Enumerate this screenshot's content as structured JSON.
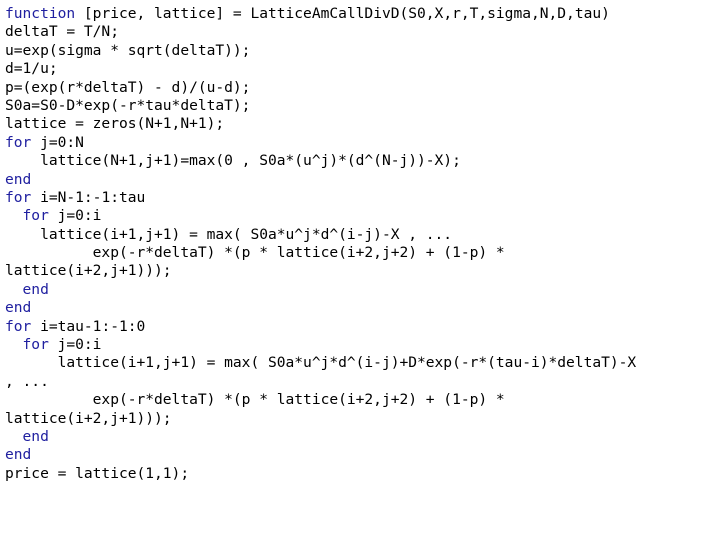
{
  "document": {
    "type": "source-code-listing",
    "language": "MATLAB",
    "function_name": "LatticeAmCallDivD",
    "background_color": "#ffffff",
    "text_color": "#000000",
    "keyword_color": "#2020a0",
    "keywords": [
      "function",
      "for",
      "end"
    ],
    "lines": [
      {
        "id": "line-1",
        "keyword": "function",
        "rest": " [price, lattice] = LatticeAmCallDivD(S0,X,r,T,sigma,N,D,tau)"
      },
      {
        "id": "line-2",
        "keyword": "",
        "rest": "deltaT = T/N;"
      },
      {
        "id": "line-3",
        "keyword": "",
        "rest": "u=exp(sigma * sqrt(deltaT));"
      },
      {
        "id": "line-4",
        "keyword": "",
        "rest": "d=1/u;"
      },
      {
        "id": "line-5",
        "keyword": "",
        "rest": "p=(exp(r*deltaT) - d)/(u-d);"
      },
      {
        "id": "line-6",
        "keyword": "",
        "rest": "S0a=S0-D*exp(-r*tau*deltaT);"
      },
      {
        "id": "line-7",
        "keyword": "",
        "rest": "lattice = zeros(N+1,N+1);"
      },
      {
        "id": "line-8",
        "keyword": "for",
        "rest": " j=0:N"
      },
      {
        "id": "line-9",
        "keyword": "",
        "rest": "    lattice(N+1,j+1)=max(0 , S0a*(u^j)*(d^(N-j))-X);"
      },
      {
        "id": "line-10",
        "keyword": "end",
        "rest": ""
      },
      {
        "id": "line-11",
        "keyword": "for",
        "rest": " i=N-1:-1:tau"
      },
      {
        "id": "line-12",
        "keyword": "  for",
        "rest": " j=0:i"
      },
      {
        "id": "line-13",
        "keyword": "",
        "rest": "    lattice(i+1,j+1) = max( S0a*u^j*d^(i-j)-X , ..."
      },
      {
        "id": "line-14",
        "keyword": "",
        "rest": "          exp(-r*deltaT) *(p * lattice(i+2,j+2) + (1-p) *"
      },
      {
        "id": "line-15",
        "keyword": "",
        "rest": "lattice(i+2,j+1)));"
      },
      {
        "id": "line-16",
        "keyword": "  end",
        "rest": ""
      },
      {
        "id": "line-17",
        "keyword": "end",
        "rest": ""
      },
      {
        "id": "line-18",
        "keyword": "for",
        "rest": " i=tau-1:-1:0"
      },
      {
        "id": "line-19",
        "keyword": "  for",
        "rest": " j=0:i"
      },
      {
        "id": "line-20",
        "keyword": "",
        "rest": "      lattice(i+1,j+1) = max( S0a*u^j*d^(i-j)+D*exp(-r*(tau-i)*deltaT)-X"
      },
      {
        "id": "line-21",
        "keyword": "",
        "rest": ", ..."
      },
      {
        "id": "line-22",
        "keyword": "",
        "rest": "          exp(-r*deltaT) *(p * lattice(i+2,j+2) + (1-p) *"
      },
      {
        "id": "line-23",
        "keyword": "",
        "rest": "lattice(i+2,j+1)));"
      },
      {
        "id": "line-24",
        "keyword": "  end",
        "rest": ""
      },
      {
        "id": "line-25",
        "keyword": "end",
        "rest": ""
      },
      {
        "id": "line-26",
        "keyword": "",
        "rest": "price = lattice(1,1);"
      }
    ]
  }
}
